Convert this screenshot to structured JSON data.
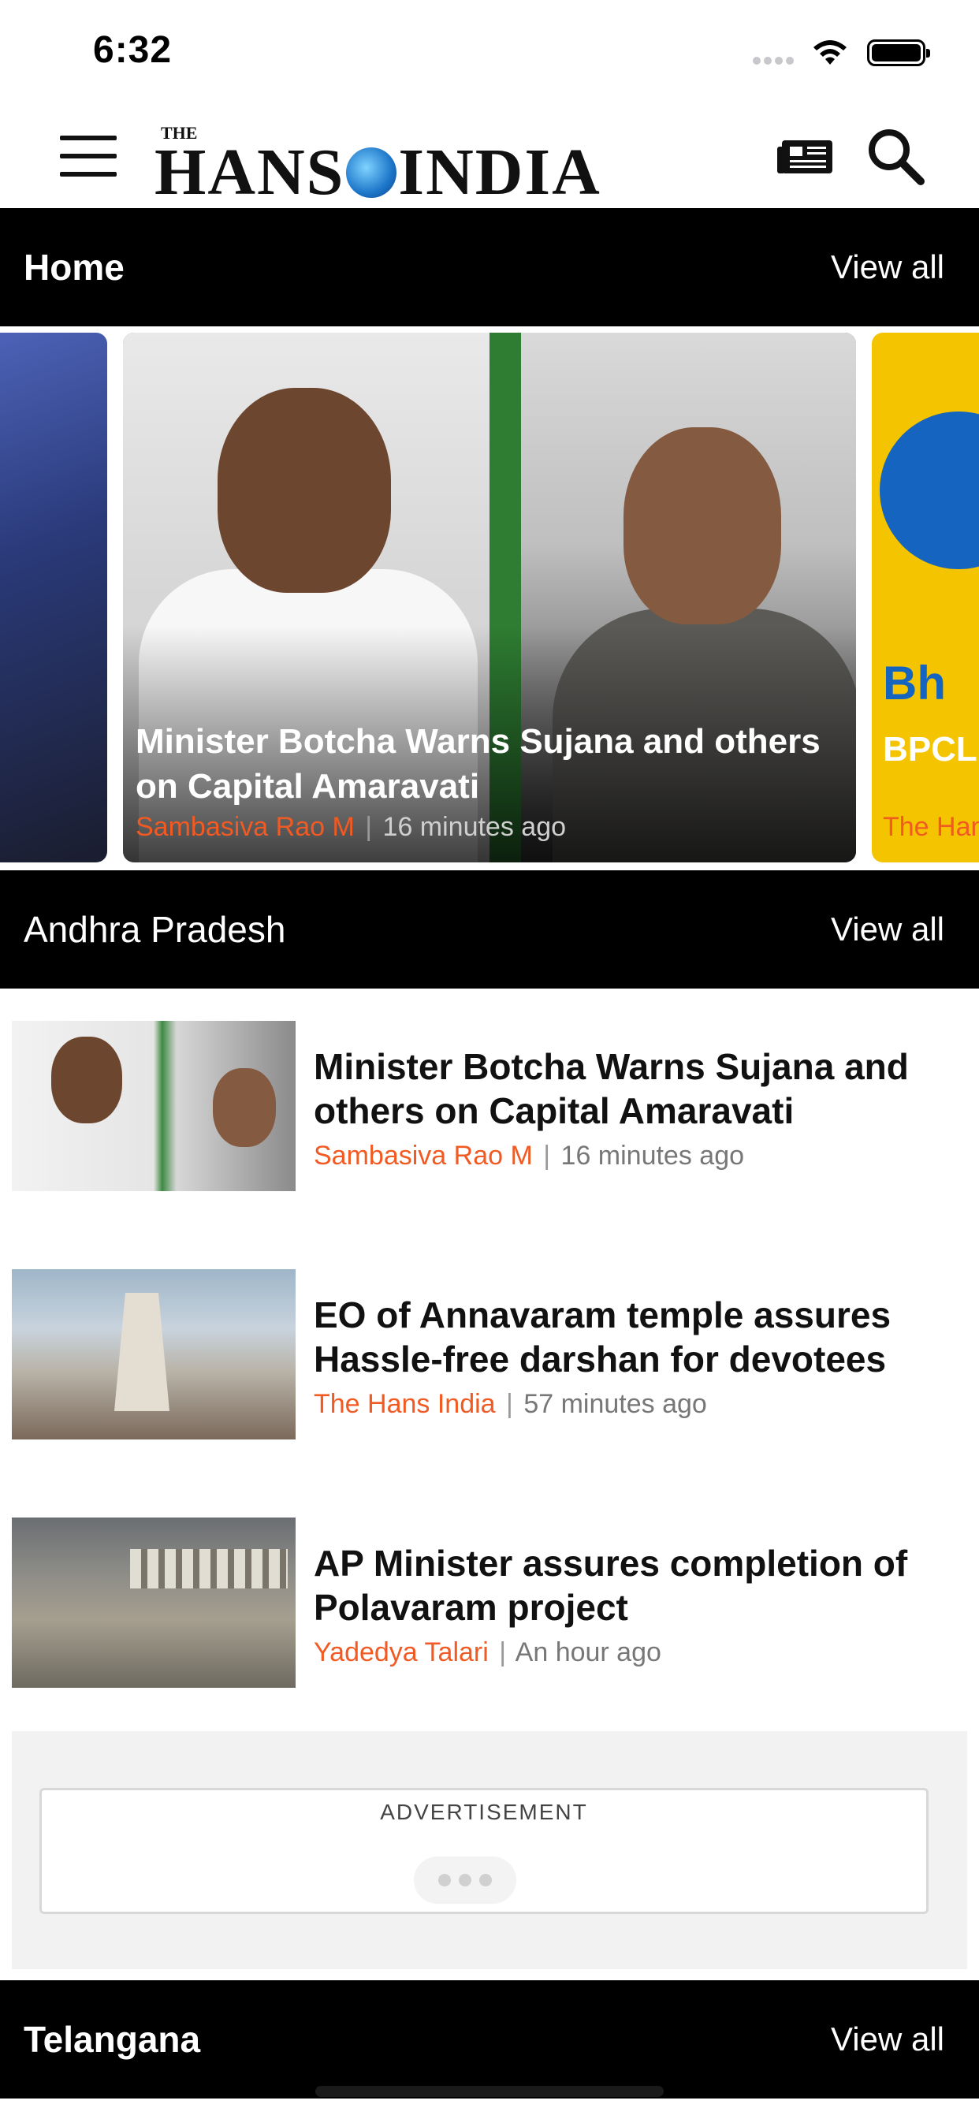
{
  "status_bar": {
    "time": "6:32"
  },
  "header": {
    "logo_small": "THE",
    "logo_left": "HANS",
    "logo_right": "INDIA"
  },
  "sections": {
    "home": {
      "title": "Home",
      "view_all": "View all",
      "cards": [
        {
          "title": "Minister Botcha Warns Sujana and others on Capital Amaravati",
          "author": "Sambasiva Rao M",
          "separator": "|",
          "time": "16 minutes ago"
        },
        {
          "brand_text": "Bh",
          "title": "BPCL floatin",
          "author": "The Han"
        }
      ]
    },
    "andhra_pradesh": {
      "title": "Andhra Pradesh",
      "view_all": "View all",
      "items": [
        {
          "title": "Minister Botcha Warns Sujana and others on Capital Amaravati",
          "author": "Sambasiva Rao M",
          "separator": "|",
          "time": "16 minutes ago"
        },
        {
          "title": "EO of Annavaram temple assures Hassle-free darshan for devotees",
          "author": "The Hans India",
          "separator": "|",
          "time": "57 minutes ago"
        },
        {
          "title": "AP Minister assures completion of Polavaram project",
          "author": "Yadedya Talari",
          "separator": "|",
          "time": "An hour ago"
        }
      ]
    },
    "telangana": {
      "title": "Telangana",
      "view_all": "View all"
    }
  },
  "advertisement": {
    "label": "ADVERTISEMENT"
  },
  "colors": {
    "accent": "#f15a22",
    "section_bar": "#000000"
  }
}
